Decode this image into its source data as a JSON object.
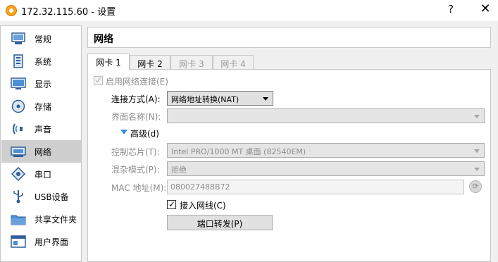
{
  "window": {
    "title": "172.32.115.60 - 设置",
    "help_label": "?",
    "close_label": "✕"
  },
  "sidebar": {
    "items": [
      {
        "label": "常规",
        "icon": "general-icon"
      },
      {
        "label": "系统",
        "icon": "system-icon"
      },
      {
        "label": "显示",
        "icon": "display-icon"
      },
      {
        "label": "存储",
        "icon": "storage-icon"
      },
      {
        "label": "声音",
        "icon": "audio-icon"
      },
      {
        "label": "网络",
        "icon": "network-icon",
        "selected": true
      },
      {
        "label": "串口",
        "icon": "serial-port-icon"
      },
      {
        "label": "USB设备",
        "icon": "usb-icon"
      },
      {
        "label": "共享文件夹",
        "icon": "shared-folder-icon"
      },
      {
        "label": "用户界面",
        "icon": "user-interface-icon"
      }
    ]
  },
  "page": {
    "title": "网络"
  },
  "tabs": [
    {
      "label": "网卡 1",
      "active": true
    },
    {
      "label": "网卡 2",
      "active": false
    },
    {
      "label": "网卡 3",
      "active": false,
      "disabled": true
    },
    {
      "label": "网卡 4",
      "active": false,
      "disabled": true
    }
  ],
  "form": {
    "enable_adapter_label": "启用网络连接(E)",
    "enable_adapter_checked": true,
    "attached_to_label": "连接方式(A):",
    "attached_to_value": "网络地址转换(NAT)",
    "name_label": "界面名称(N):",
    "name_value": "",
    "advanced_label": "高级(d)",
    "adapter_type_label": "控制芯片(T):",
    "adapter_type_value": "Intel PRO/1000 MT 桌面 (82540EM)",
    "promiscuous_label": "混杂模式(P):",
    "promiscuous_value": "拒绝",
    "mac_label": "MAC 地址(M):",
    "mac_value": "080027488B72",
    "cable_connected_label": "接入网线(C)",
    "cable_connected_checked": true,
    "port_forwarding_label": "端口转发(P)"
  },
  "colors": {
    "accent": "#3a8fd8",
    "selected_bg": "#cfcfcf",
    "disabled_text": "#8c8c8c"
  }
}
